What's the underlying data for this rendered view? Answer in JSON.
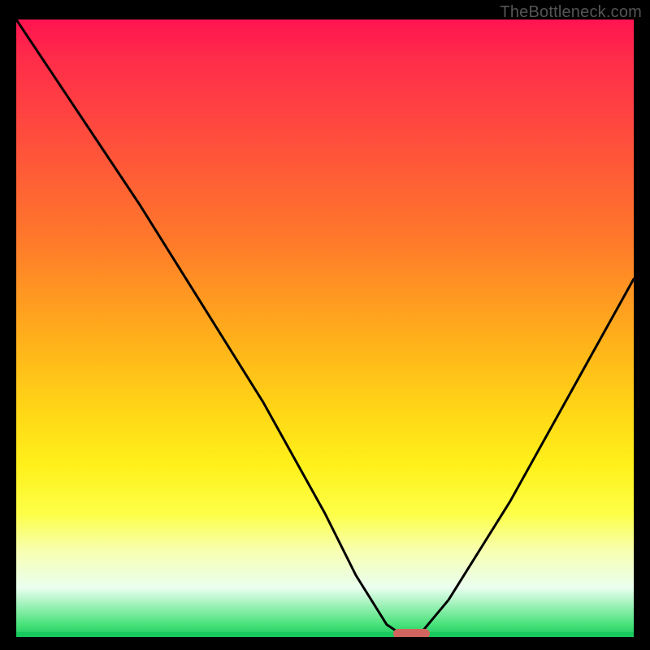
{
  "watermark": "TheBottleneck.com",
  "chart_data": {
    "type": "line",
    "title": "",
    "xlabel": "",
    "ylabel": "",
    "xlim": [
      0,
      100
    ],
    "ylim": [
      0,
      100
    ],
    "grid": false,
    "legend": false,
    "series": [
      {
        "name": "bottleneck-curve",
        "x": [
          0,
          10,
          20,
          30,
          40,
          50,
          55,
          60,
          63,
          65,
          70,
          80,
          90,
          100
        ],
        "y": [
          100,
          85,
          70,
          54,
          38,
          20,
          10,
          2,
          0,
          0,
          6,
          22,
          40,
          58
        ]
      }
    ],
    "marker": {
      "name": "optimal-range",
      "x_start": 61,
      "x_end": 67,
      "y": 0
    },
    "background_gradient": {
      "top": "#ff1450",
      "mid": "#ffd516",
      "bottom": "#18c95e"
    }
  },
  "colors": {
    "frame": "#000000",
    "curve": "#000000",
    "pill": "#d0655f",
    "watermark": "#555555"
  }
}
